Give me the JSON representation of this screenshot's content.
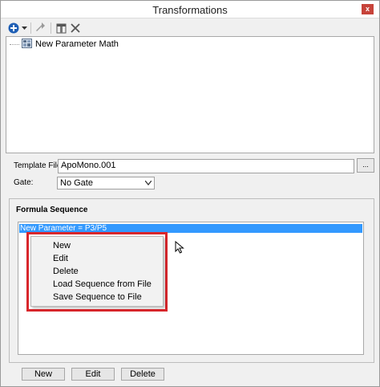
{
  "window": {
    "title": "Transformations",
    "close_label": "x"
  },
  "toolbar": {
    "icons": [
      "add-icon",
      "dropdown-arrow-icon",
      "move-icon",
      "template-icon",
      "delete-icon"
    ]
  },
  "tree": {
    "item_label": "New Parameter Math",
    "item_icon": "parameter-math-icon"
  },
  "template": {
    "label": "Template File:",
    "value": "ApoMono.001",
    "browse_label": "..."
  },
  "gate": {
    "label": "Gate:",
    "value": "No Gate"
  },
  "formula_sequence": {
    "title": "Formula Sequence",
    "items": [
      "New Parameter = P3/P5"
    ]
  },
  "context_menu": {
    "items": [
      "New",
      "Edit",
      "Delete",
      "Load Sequence from File",
      "Save Sequence to File"
    ]
  },
  "buttons": {
    "new_label": "New",
    "edit_label": "Edit",
    "delete_label": "Delete"
  },
  "colors": {
    "selection": "#3399ff",
    "highlight_frame": "#d9262c",
    "close_button": "#c7433a"
  }
}
